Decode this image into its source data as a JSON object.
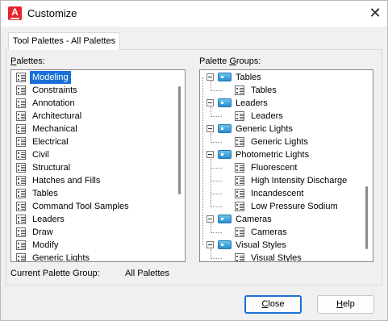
{
  "window": {
    "title": "Customize",
    "app_icon_letter": "A",
    "close_glyph": "✕"
  },
  "tabs": [
    {
      "label": "Tool Palettes - All Palettes",
      "active": true
    }
  ],
  "palettes": {
    "label_underlined": "P",
    "label_rest": "alettes:",
    "selected_index": 0,
    "items": [
      "Modeling",
      "Constraints",
      "Annotation",
      "Architectural",
      "Mechanical",
      "Electrical",
      "Civil",
      "Structural",
      "Hatches and Fills",
      "Tables",
      "Command Tool Samples",
      "Leaders",
      "Draw",
      "Modify",
      "Generic Lights"
    ]
  },
  "palette_groups": {
    "label_before": "Palette ",
    "label_underlined": "G",
    "label_after": "roups:",
    "tree": [
      {
        "type": "group",
        "label": "Tables"
      },
      {
        "type": "palette",
        "label": "Tables"
      },
      {
        "type": "group",
        "label": "Leaders"
      },
      {
        "type": "palette",
        "label": "Leaders"
      },
      {
        "type": "group",
        "label": "Generic Lights"
      },
      {
        "type": "palette",
        "label": "Generic Lights"
      },
      {
        "type": "group",
        "label": "Photometric Lights"
      },
      {
        "type": "palette",
        "label": "Fluorescent"
      },
      {
        "type": "palette",
        "label": "High Intensity Discharge"
      },
      {
        "type": "palette",
        "label": "Incandescent"
      },
      {
        "type": "palette",
        "label": "Low Pressure Sodium"
      },
      {
        "type": "group",
        "label": "Cameras"
      },
      {
        "type": "palette",
        "label": "Cameras"
      },
      {
        "type": "group",
        "label": "Visual Styles"
      },
      {
        "type": "palette",
        "label": "Visual Styles"
      }
    ]
  },
  "current_group": {
    "label": "Current Palette Group:",
    "value": "All Palettes"
  },
  "buttons": {
    "close_underlined": "C",
    "close_rest": "lose",
    "help_underlined": "H",
    "help_rest": "elp"
  },
  "colors": {
    "selection": "#1b70d7",
    "app_icon": "#e8242e",
    "group_icon": "#2a8fd0"
  }
}
